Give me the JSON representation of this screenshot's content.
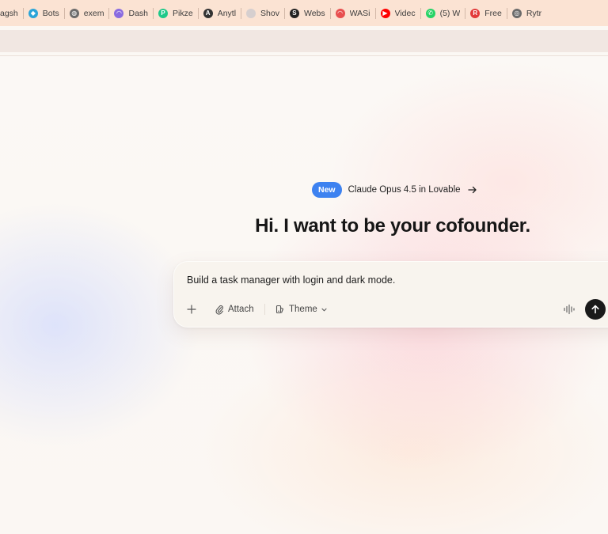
{
  "bookmarks": [
    {
      "label": "agsh",
      "icon": "none",
      "color": "#9aa0a6"
    },
    {
      "label": "Bots",
      "icon": "bot-icon",
      "color": "#2aa4d8"
    },
    {
      "label": "exem",
      "icon": "globe-icon",
      "color": "#6b6b6b"
    },
    {
      "label": "Dash",
      "icon": "dash-icon",
      "color": "#8a6be0"
    },
    {
      "label": "Pikze",
      "icon": "pikzels-icon",
      "color": "#1ec98a"
    },
    {
      "label": "Anytl",
      "icon": "anything-icon",
      "color": "#333333"
    },
    {
      "label": "Shov",
      "icon": "circle-icon",
      "color": "#d6cfcf"
    },
    {
      "label": "Webs",
      "icon": "s-icon",
      "color": "#222222"
    },
    {
      "label": "WASi",
      "icon": "rainbow-icon",
      "color": "#e84f4f"
    },
    {
      "label": "Videc",
      "icon": "youtube-icon",
      "color": "#ff0000"
    },
    {
      "label": "(5) W",
      "icon": "whatsapp-icon",
      "color": "#25d366"
    },
    {
      "label": "Free",
      "icon": "r-icon",
      "color": "#e23b3b"
    },
    {
      "label": "Rytr",
      "icon": "rytr-icon",
      "color": "#6b6b6b"
    }
  ],
  "announcement": {
    "badge": "New",
    "text": "Claude Opus 4.5 in Lovable"
  },
  "headline": "Hi. I want to be your cofounder.",
  "prompt": {
    "value": "Build a task manager with login and dark mode.",
    "attach_label": "Attach",
    "theme_label": "Theme"
  },
  "colors": {
    "accent_blue": "#3d82f0",
    "send_button": "#1a1a1a",
    "bookmarks_bar": "#fbe3d3"
  }
}
